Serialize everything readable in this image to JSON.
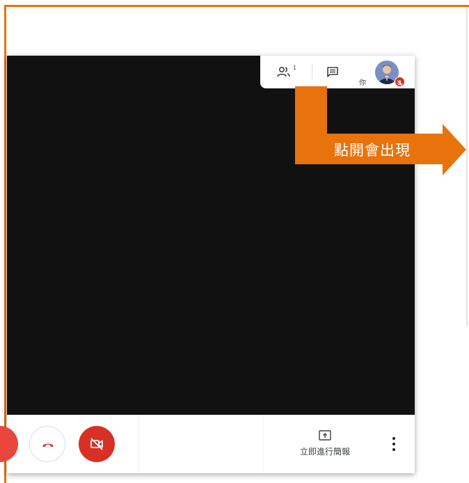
{
  "meeting": {
    "participants_count": "1",
    "self_label": "你"
  },
  "toolbar": {
    "present_label": "立即進行簡報"
  },
  "annotation": {
    "arrow_text": "點開會出現",
    "color": "#e8720c"
  },
  "colors": {
    "frame": "#e8720c",
    "video_bg": "#111111",
    "danger_red": "#d93025",
    "panel_bg": "#ffffff"
  },
  "icons": {
    "people": "people-icon",
    "chat": "chat-icon",
    "mic_off": "mic-off-icon",
    "hangup": "phone-hangup-icon",
    "camera_off": "camera-off-icon",
    "present": "present-screen-icon",
    "more": "more-vert-icon"
  }
}
